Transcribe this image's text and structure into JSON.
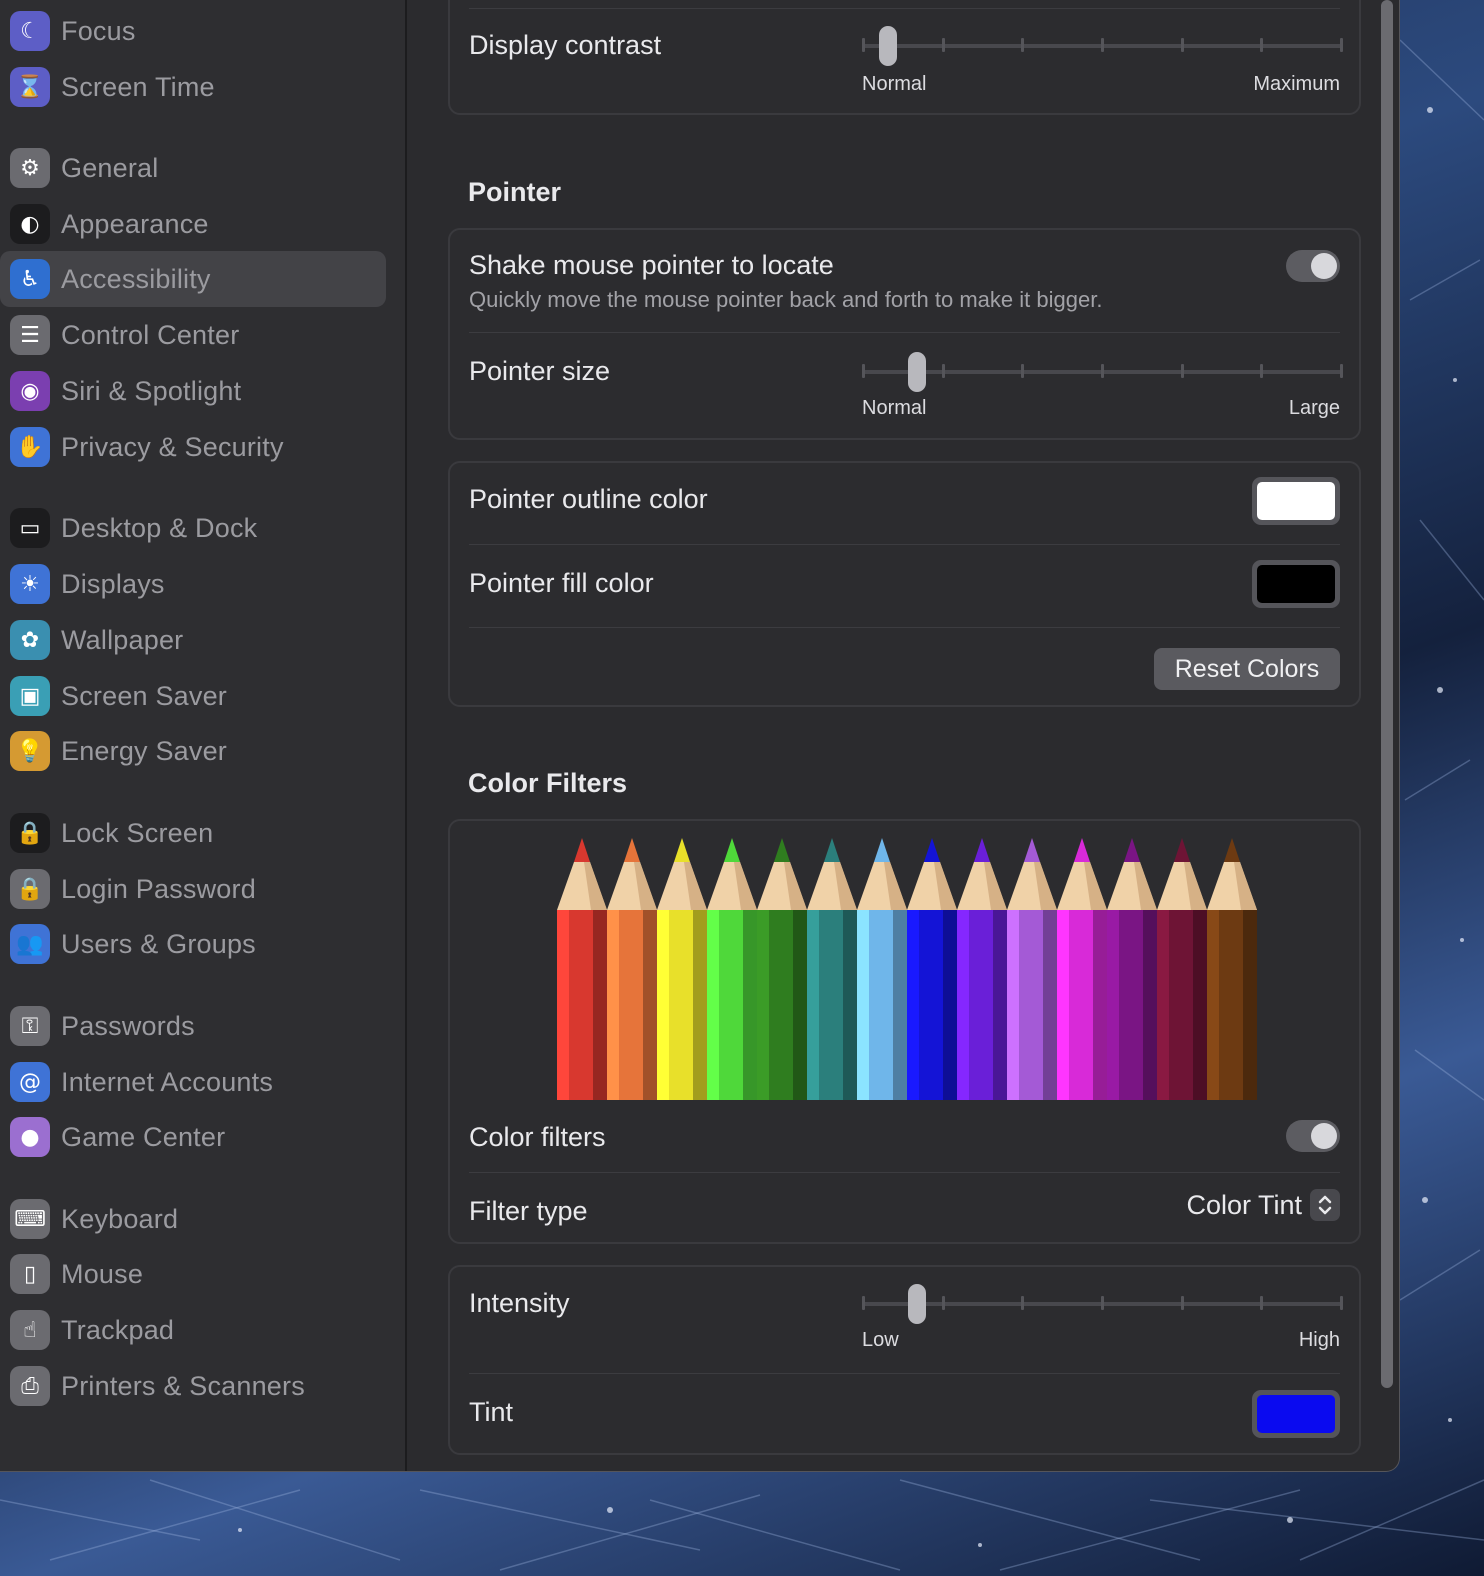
{
  "sidebar": {
    "items": [
      {
        "label": "Focus",
        "icon": "moon-icon",
        "color": "#5d5ec6",
        "glyph": "☾"
      },
      {
        "label": "Screen Time",
        "icon": "hourglass-icon",
        "color": "#5d5ec6",
        "glyph": "⌛"
      },
      {
        "label": "General",
        "icon": "gear-icon",
        "color": "#6b6b70",
        "glyph": "⚙"
      },
      {
        "label": "Appearance",
        "icon": "appearance-icon",
        "color": "#1c1c1e",
        "glyph": "◐"
      },
      {
        "label": "Accessibility",
        "icon": "accessibility-icon",
        "color": "#2f6fd0",
        "glyph": "♿"
      },
      {
        "label": "Control Center",
        "icon": "control-center-icon",
        "color": "#6b6b70",
        "glyph": "☰"
      },
      {
        "label": "Siri & Spotlight",
        "icon": "siri-icon",
        "color": "#7b3fb0",
        "glyph": "◉"
      },
      {
        "label": "Privacy & Security",
        "icon": "hand-icon",
        "color": "#3f73d6",
        "glyph": "✋"
      },
      {
        "label": "Desktop & Dock",
        "icon": "dock-icon",
        "color": "#1c1c1e",
        "glyph": "▭"
      },
      {
        "label": "Displays",
        "icon": "sun-icon",
        "color": "#3f73d6",
        "glyph": "☀"
      },
      {
        "label": "Wallpaper",
        "icon": "flower-icon",
        "color": "#3a8fb0",
        "glyph": "✿"
      },
      {
        "label": "Screen Saver",
        "icon": "screen-saver-icon",
        "color": "#3a9fb5",
        "glyph": "▣"
      },
      {
        "label": "Energy Saver",
        "icon": "lightbulb-icon",
        "color": "#d59a32",
        "glyph": "💡"
      },
      {
        "label": "Lock Screen",
        "icon": "lock-icon",
        "color": "#1c1c1e",
        "glyph": "🔒"
      },
      {
        "label": "Login Password",
        "icon": "padlock-icon",
        "color": "#6b6b70",
        "glyph": "🔒"
      },
      {
        "label": "Users & Groups",
        "icon": "users-icon",
        "color": "#3f73d6",
        "glyph": "👥"
      },
      {
        "label": "Passwords",
        "icon": "key-icon",
        "color": "#6b6b70",
        "glyph": "⚿"
      },
      {
        "label": "Internet Accounts",
        "icon": "at-icon",
        "color": "#3f73d6",
        "glyph": "@"
      },
      {
        "label": "Game Center",
        "icon": "game-center-icon",
        "color": "#9b6fd0",
        "glyph": "●"
      },
      {
        "label": "Keyboard",
        "icon": "keyboard-icon",
        "color": "#6b6b70",
        "glyph": "⌨"
      },
      {
        "label": "Mouse",
        "icon": "mouse-icon",
        "color": "#6b6b70",
        "glyph": "▯"
      },
      {
        "label": "Trackpad",
        "icon": "trackpad-icon",
        "color": "#6b6b70",
        "glyph": "☝"
      },
      {
        "label": "Printers & Scanners",
        "icon": "printer-icon",
        "color": "#6b6b70",
        "glyph": "⎙"
      }
    ],
    "active_index": 4
  },
  "display": {
    "contrast_label": "Display contrast",
    "contrast_min": "Normal",
    "contrast_max": "Maximum",
    "contrast_value": 0.05
  },
  "pointer": {
    "section_title": "Pointer",
    "shake_title": "Shake mouse pointer to locate",
    "shake_sub": "Quickly move the mouse pointer back and forth to make it bigger.",
    "shake_on": true,
    "size_label": "Pointer size",
    "size_min": "Normal",
    "size_max": "Large",
    "size_value": 0.11,
    "outline_label": "Pointer outline color",
    "outline_color": "#ffffff",
    "fill_label": "Pointer fill color",
    "fill_color": "#000000",
    "reset_label": "Reset Colors"
  },
  "filters": {
    "section_title": "Color Filters",
    "pencil_colors": [
      "#d8382f",
      "#e6743a",
      "#e8e02a",
      "#4fd83a",
      "#2f7d1f",
      "#2b7f7c",
      "#6fb6ea",
      "#1414d6",
      "#6a1fd8",
      "#a45ad6",
      "#d82ad8",
      "#7a1584",
      "#6e1435",
      "#6d3a12"
    ],
    "toggle_label": "Color filters",
    "toggle_on": true,
    "type_label": "Filter type",
    "type_value": "Color Tint",
    "intensity_label": "Intensity",
    "intensity_min": "Low",
    "intensity_max": "High",
    "intensity_value": 0.11,
    "tint_label": "Tint",
    "tint_color": "#0a0af0"
  }
}
